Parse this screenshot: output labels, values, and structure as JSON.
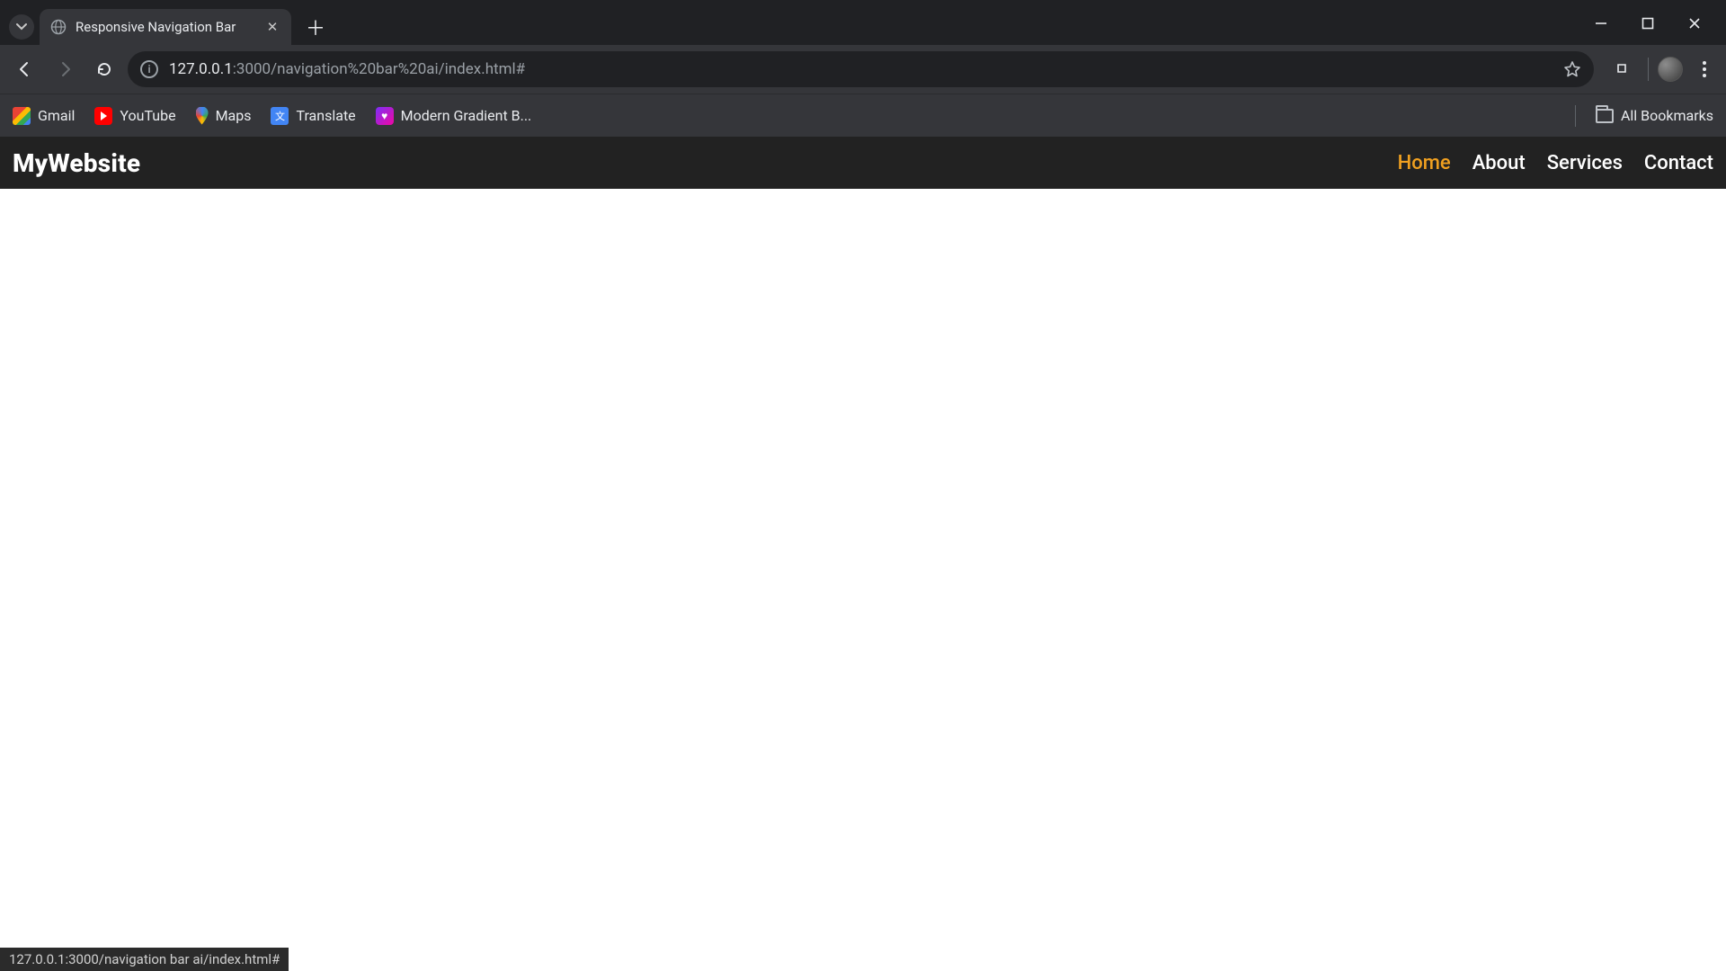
{
  "browser": {
    "tab_title": "Responsive Navigation Bar",
    "url_host": "127.0.0.1",
    "url_port_path": ":3000/navigation%20bar%20ai/index.html#",
    "bookmarks": [
      {
        "label": "Gmail"
      },
      {
        "label": "YouTube"
      },
      {
        "label": "Maps"
      },
      {
        "label": "Translate"
      },
      {
        "label": "Modern Gradient B..."
      }
    ],
    "all_bookmarks_label": "All Bookmarks",
    "status_text": "127.0.0.1:3000/navigation bar ai/index.html#"
  },
  "site": {
    "logo": "MyWebsite",
    "nav": [
      {
        "label": "Home",
        "active": true
      },
      {
        "label": "About",
        "active": false
      },
      {
        "label": "Services",
        "active": false
      },
      {
        "label": "Contact",
        "active": false
      }
    ]
  }
}
